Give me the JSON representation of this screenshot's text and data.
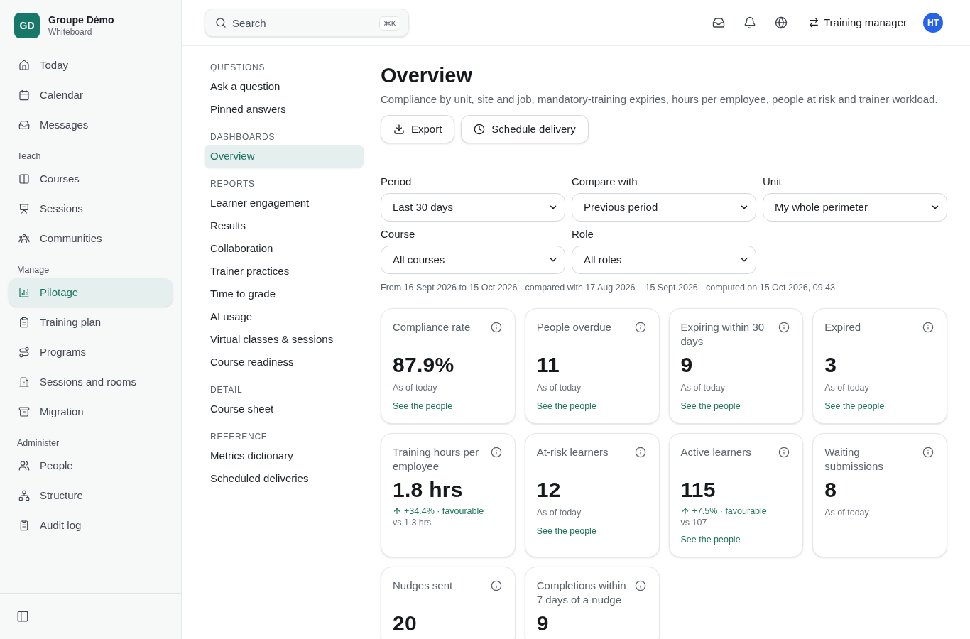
{
  "sidebar": {
    "workspace": {
      "initials": "GD",
      "name": "Groupe Démo",
      "subtitle": "Whiteboard"
    },
    "sections": [
      {
        "items": [
          {
            "label": "Today",
            "selected": false
          },
          {
            "label": "Calendar",
            "selected": false
          },
          {
            "label": "Messages",
            "selected": false
          }
        ]
      },
      {
        "title": "Teach",
        "items": [
          {
            "label": "Courses",
            "selected": false
          },
          {
            "label": "Sessions",
            "selected": false
          },
          {
            "label": "Communities",
            "selected": false
          }
        ]
      },
      {
        "title": "Manage",
        "items": [
          {
            "label": "Pilotage",
            "selected": true
          },
          {
            "label": "Training plan",
            "selected": false
          },
          {
            "label": "Programs",
            "selected": false
          },
          {
            "label": "Sessions and rooms",
            "selected": false
          },
          {
            "label": "Migration",
            "selected": false
          }
        ]
      },
      {
        "title": "Administer",
        "items": [
          {
            "label": "People",
            "selected": false
          },
          {
            "label": "Structure",
            "selected": false
          },
          {
            "label": "Audit log",
            "selected": false
          }
        ]
      }
    ]
  },
  "top_bar": {
    "search": {
      "placeholder": "Search",
      "shortcut": "⌘K"
    },
    "role": "Training manager",
    "avatar": "HT"
  },
  "subnav": {
    "sections": [
      {
        "title": "QUESTIONS",
        "items": [
          {
            "label": "Ask a question",
            "selected": false
          },
          {
            "label": "Pinned answers",
            "selected": false
          }
        ]
      },
      {
        "title": "DASHBOARDS",
        "items": [
          {
            "label": "Overview",
            "selected": true
          }
        ]
      },
      {
        "title": "REPORTS",
        "items": [
          {
            "label": "Learner engagement",
            "selected": false
          },
          {
            "label": "Results",
            "selected": false
          },
          {
            "label": "Collaboration",
            "selected": false
          },
          {
            "label": "Trainer practices",
            "selected": false
          },
          {
            "label": "Time to grade",
            "selected": false
          },
          {
            "label": "AI usage",
            "selected": false
          },
          {
            "label": "Virtual classes & sessions",
            "selected": false
          },
          {
            "label": "Course readiness",
            "selected": false
          }
        ]
      },
      {
        "title": "DETAIL",
        "items": [
          {
            "label": "Course sheet",
            "selected": false
          }
        ]
      },
      {
        "title": "REFERENCE",
        "items": [
          {
            "label": "Metrics dictionary",
            "selected": false
          },
          {
            "label": "Scheduled deliveries",
            "selected": false
          }
        ]
      }
    ]
  },
  "main": {
    "title": "Overview",
    "description": "Compliance by unit, site and job, mandatory-training expiries, hours per employee, people at risk and trainer workload.",
    "actions": [
      {
        "label": "Export"
      },
      {
        "label": "Schedule delivery"
      }
    ],
    "filters": [
      {
        "label": "Period",
        "value": "Last 30 days"
      },
      {
        "label": "Compare with",
        "value": "Previous period"
      },
      {
        "label": "Unit",
        "value": "My whole perimeter"
      },
      {
        "label": "Course",
        "value": "All courses"
      },
      {
        "label": "Role",
        "value": "All roles"
      }
    ],
    "range_info": "From 16 Sept 2026 to 15 Oct 2026 · compared with 17 Aug 2026 – 15 Sept 2026 · computed on 15 Oct 2026, 09:43",
    "cards": [
      {
        "title": "Compliance rate",
        "value": "87.9%",
        "note": "As of today",
        "link": "See the people"
      },
      {
        "title": "People overdue",
        "value": "11",
        "note": "As of today",
        "link": "See the people"
      },
      {
        "title": "Expiring within 30 days",
        "value": "9",
        "note": "As of today",
        "link": "See the people"
      },
      {
        "title": "Expired",
        "value": "3",
        "note": "As of today",
        "link": "See the people"
      },
      {
        "title": "Training hours per employee",
        "value": "1.8 hrs",
        "trend": {
          "rising": true,
          "text": "+34.4% · favourable"
        },
        "comparison": "vs 1.3 hrs"
      },
      {
        "title": "At-risk learners",
        "value": "12",
        "note": "As of today",
        "link": "See the people"
      },
      {
        "title": "Active learners",
        "value": "115",
        "trend": {
          "rising": true,
          "text": "+7.5% · favourable"
        },
        "comparison": "vs 107",
        "link": "See the people"
      },
      {
        "title": "Waiting submissions",
        "value": "8",
        "note": "As of today"
      },
      {
        "title": "Nudges sent",
        "value": "20"
      },
      {
        "title": "Completions within 7 days of a nudge",
        "value": "9"
      }
    ]
  }
}
